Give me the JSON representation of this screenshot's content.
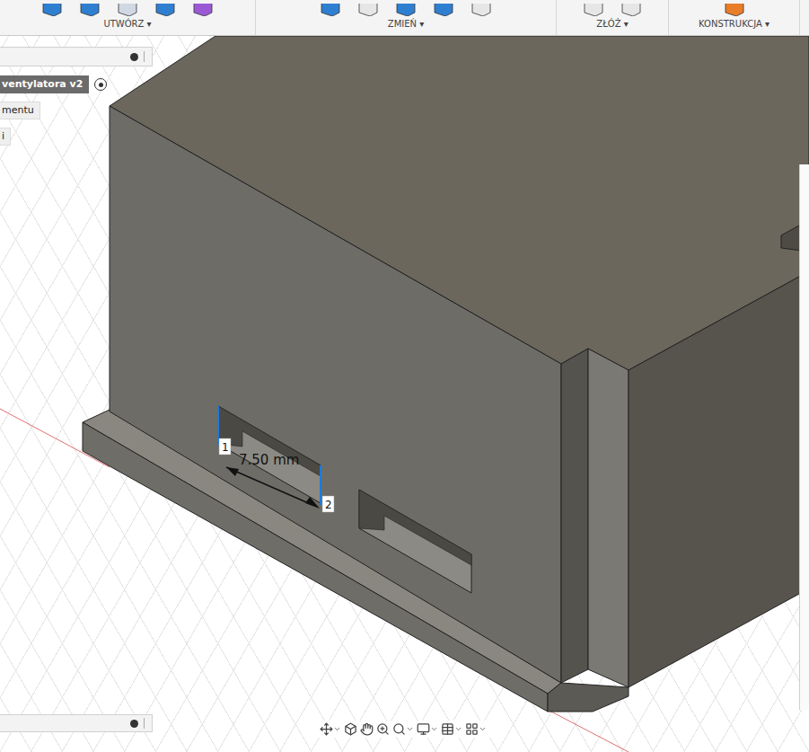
{
  "toolbar": {
    "groups": [
      {
        "label": "UTWÓRZ ▾"
      },
      {
        "label": "ZMIEŃ ▾"
      },
      {
        "label": "ZŁÓŻ ▾"
      },
      {
        "label": "KONSTRUKCJA ▾"
      }
    ]
  },
  "browser": {
    "items": [
      {
        "label": "ventylatora v2",
        "selected": true
      },
      {
        "label": "mentu",
        "selected": false
      },
      {
        "label": "i",
        "selected": false
      }
    ]
  },
  "model": {
    "dimension": "7.50 mm",
    "points": [
      "1",
      "2"
    ]
  }
}
